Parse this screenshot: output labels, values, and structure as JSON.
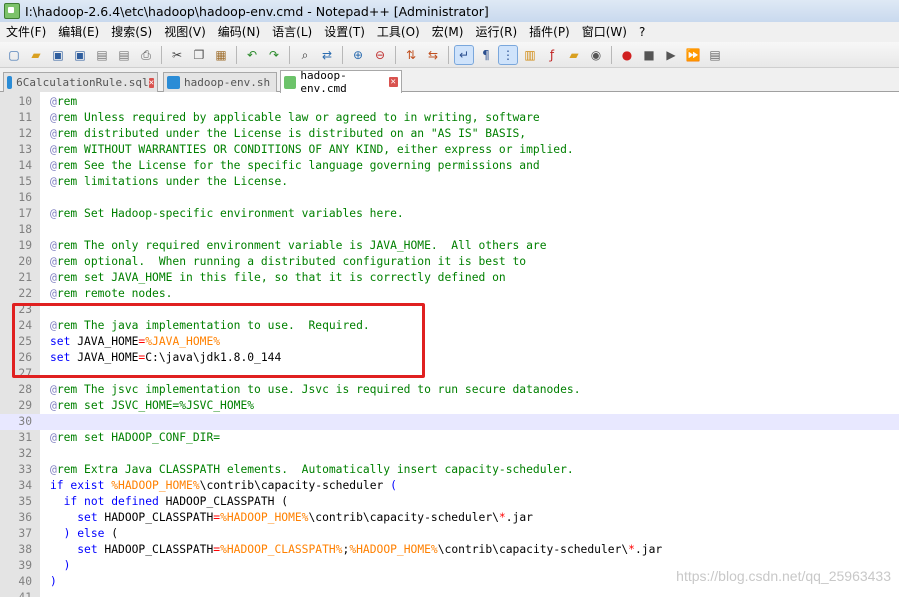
{
  "window": {
    "title": "I:\\hadoop-2.6.4\\etc\\hadoop\\hadoop-env.cmd - Notepad++ [Administrator]"
  },
  "menu": [
    "文件(F)",
    "编辑(E)",
    "搜索(S)",
    "视图(V)",
    "编码(N)",
    "语言(L)",
    "设置(T)",
    "工具(O)",
    "宏(M)",
    "运行(R)",
    "插件(P)",
    "窗口(W)",
    "?"
  ],
  "toolbar": {
    "groups": [
      [
        "new-file-icon",
        "open-file-icon",
        "save-icon",
        "save-all-icon",
        "close-icon",
        "close-all-icon",
        "print-icon"
      ],
      [
        "cut-icon",
        "copy-icon",
        "paste-icon"
      ],
      [
        "undo-icon",
        "redo-icon"
      ],
      [
        "find-icon",
        "replace-icon"
      ],
      [
        "zoom-in-icon",
        "zoom-out-icon"
      ],
      [
        "sync-vertical-icon",
        "sync-horizontal-icon"
      ],
      [
        "word-wrap-icon",
        "show-all-chars-icon",
        "indent-guide-icon",
        "doc-map-icon",
        "function-list-icon",
        "folder-workspace-icon",
        "monitor-icon"
      ],
      [
        "record-macro-icon",
        "stop-record-icon",
        "play-macro-icon",
        "run-macro-multiple-icon",
        "save-macro-icon"
      ]
    ]
  },
  "tabs": [
    {
      "label": "6CalculationRule.sql",
      "active": false
    },
    {
      "label": "hadoop-env.sh",
      "active": false
    },
    {
      "label": "hadoop-env.cmd",
      "active": true
    }
  ],
  "editor": {
    "lines": [
      {
        "n": "10",
        "tokens": [
          [
            "at",
            "@"
          ],
          [
            "cm",
            "rem"
          ]
        ]
      },
      {
        "n": "11",
        "tokens": [
          [
            "at",
            "@"
          ],
          [
            "cm",
            "rem Unless required by applicable law or agreed to in writing, software"
          ]
        ]
      },
      {
        "n": "12",
        "tokens": [
          [
            "at",
            "@"
          ],
          [
            "cm",
            "rem distributed under the License is distributed on an \"AS IS\" BASIS,"
          ]
        ]
      },
      {
        "n": "13",
        "tokens": [
          [
            "at",
            "@"
          ],
          [
            "cm",
            "rem WITHOUT WARRANTIES OR CONDITIONS OF ANY KIND, either express or implied."
          ]
        ]
      },
      {
        "n": "14",
        "tokens": [
          [
            "at",
            "@"
          ],
          [
            "cm",
            "rem See the License for the specific language governing permissions and"
          ]
        ]
      },
      {
        "n": "15",
        "tokens": [
          [
            "at",
            "@"
          ],
          [
            "cm",
            "rem limitations under the License."
          ]
        ]
      },
      {
        "n": "16",
        "tokens": []
      },
      {
        "n": "17",
        "tokens": [
          [
            "at",
            "@"
          ],
          [
            "cm",
            "rem Set Hadoop-specific environment variables here."
          ]
        ]
      },
      {
        "n": "18",
        "tokens": []
      },
      {
        "n": "19",
        "tokens": [
          [
            "at",
            "@"
          ],
          [
            "cm",
            "rem The only required environment variable is JAVA_HOME.  All others are"
          ]
        ]
      },
      {
        "n": "20",
        "tokens": [
          [
            "at",
            "@"
          ],
          [
            "cm",
            "rem optional.  When running a distributed configuration it is best to"
          ]
        ]
      },
      {
        "n": "21",
        "tokens": [
          [
            "at",
            "@"
          ],
          [
            "cm",
            "rem set JAVA_HOME in this file, so that it is correctly defined on"
          ]
        ]
      },
      {
        "n": "22",
        "tokens": [
          [
            "at",
            "@"
          ],
          [
            "cm",
            "rem remote nodes."
          ]
        ]
      },
      {
        "n": "23",
        "tokens": []
      },
      {
        "n": "24",
        "tokens": [
          [
            "at",
            "@"
          ],
          [
            "cm",
            "rem The java implementation to use.  Required."
          ]
        ]
      },
      {
        "n": "25",
        "tokens": [
          [
            "kw",
            "set"
          ],
          [
            "plain",
            " JAVA_HOME"
          ],
          [
            "op",
            "="
          ],
          [
            "var",
            "%JAVA_HOME%"
          ]
        ]
      },
      {
        "n": "26",
        "tokens": [
          [
            "kw",
            "set"
          ],
          [
            "plain",
            " JAVA_HOME"
          ],
          [
            "op",
            "="
          ],
          [
            "plain",
            "C:\\java\\jdk1.8.0_144"
          ]
        ]
      },
      {
        "n": "27",
        "tokens": []
      },
      {
        "n": "28",
        "tokens": [
          [
            "at",
            "@"
          ],
          [
            "cm",
            "rem The jsvc implementation to use. Jsvc is required to run secure datanodes."
          ]
        ]
      },
      {
        "n": "29",
        "tokens": [
          [
            "at",
            "@"
          ],
          [
            "cm",
            "rem set JSVC_HOME=%JSVC_HOME%"
          ]
        ]
      },
      {
        "n": "30",
        "tokens": [],
        "current": true
      },
      {
        "n": "31",
        "tokens": [
          [
            "at",
            "@"
          ],
          [
            "cm",
            "rem set HADOOP_CONF_DIR="
          ]
        ]
      },
      {
        "n": "32",
        "tokens": []
      },
      {
        "n": "33",
        "tokens": [
          [
            "at",
            "@"
          ],
          [
            "cm",
            "rem Extra Java CLASSPATH elements.  Automatically insert capacity-scheduler."
          ]
        ]
      },
      {
        "n": "34",
        "tokens": [
          [
            "kw",
            "if exist"
          ],
          [
            "plain",
            " "
          ],
          [
            "var",
            "%HADOOP_HOME%"
          ],
          [
            "plain",
            "\\contrib\\capacity-scheduler "
          ],
          [
            "kw",
            "("
          ]
        ]
      },
      {
        "n": "35",
        "tokens": [
          [
            "plain",
            "  "
          ],
          [
            "kw",
            "if not defined"
          ],
          [
            "plain",
            " HADOOP_CLASSPATH ("
          ]
        ]
      },
      {
        "n": "36",
        "tokens": [
          [
            "plain",
            "    "
          ],
          [
            "kw",
            "set"
          ],
          [
            "plain",
            " HADOOP_CLASSPATH"
          ],
          [
            "op",
            "="
          ],
          [
            "var",
            "%HADOOP_HOME%"
          ],
          [
            "plain",
            "\\contrib\\capacity-scheduler\\"
          ],
          [
            "op",
            "*"
          ],
          [
            "plain",
            ".jar"
          ]
        ]
      },
      {
        "n": "37",
        "tokens": [
          [
            "plain",
            "  "
          ],
          [
            "kw",
            ")"
          ],
          [
            "plain",
            " "
          ],
          [
            "kw",
            "else"
          ],
          [
            "plain",
            " ("
          ]
        ]
      },
      {
        "n": "38",
        "tokens": [
          [
            "plain",
            "    "
          ],
          [
            "kw",
            "set"
          ],
          [
            "plain",
            " HADOOP_CLASSPATH"
          ],
          [
            "op",
            "="
          ],
          [
            "var",
            "%HADOOP_CLASSPATH%"
          ],
          [
            "plain",
            ";"
          ],
          [
            "var",
            "%HADOOP_HOME%"
          ],
          [
            "plain",
            "\\contrib\\capacity-scheduler\\"
          ],
          [
            "op",
            "*"
          ],
          [
            "plain",
            ".jar"
          ]
        ]
      },
      {
        "n": "39",
        "tokens": [
          [
            "plain",
            "  "
          ],
          [
            "kw",
            ")"
          ]
        ]
      },
      {
        "n": "40",
        "tokens": [
          [
            "kw",
            ")"
          ]
        ]
      },
      {
        "n": "41",
        "tokens": []
      }
    ]
  },
  "watermark": "https://blog.csdn.net/qq_25963433",
  "colors": {
    "comment": "#008000",
    "keyword": "#0000ff",
    "variable": "#ff8000",
    "operator": "#ff0000",
    "highlight_box": "#e02020",
    "current_line": "#e8e8ff"
  }
}
